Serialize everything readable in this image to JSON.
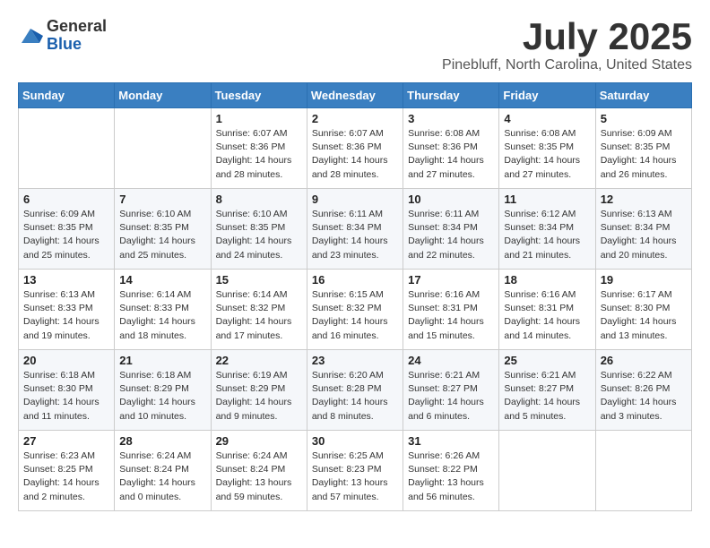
{
  "logo": {
    "general": "General",
    "blue": "Blue"
  },
  "title": "July 2025",
  "subtitle": "Pinebluff, North Carolina, United States",
  "days_of_week": [
    "Sunday",
    "Monday",
    "Tuesday",
    "Wednesday",
    "Thursday",
    "Friday",
    "Saturday"
  ],
  "weeks": [
    [
      {
        "day": "",
        "info": ""
      },
      {
        "day": "",
        "info": ""
      },
      {
        "day": "1",
        "info": "Sunrise: 6:07 AM\nSunset: 8:36 PM\nDaylight: 14 hours and 28 minutes."
      },
      {
        "day": "2",
        "info": "Sunrise: 6:07 AM\nSunset: 8:36 PM\nDaylight: 14 hours and 28 minutes."
      },
      {
        "day": "3",
        "info": "Sunrise: 6:08 AM\nSunset: 8:36 PM\nDaylight: 14 hours and 27 minutes."
      },
      {
        "day": "4",
        "info": "Sunrise: 6:08 AM\nSunset: 8:35 PM\nDaylight: 14 hours and 27 minutes."
      },
      {
        "day": "5",
        "info": "Sunrise: 6:09 AM\nSunset: 8:35 PM\nDaylight: 14 hours and 26 minutes."
      }
    ],
    [
      {
        "day": "6",
        "info": "Sunrise: 6:09 AM\nSunset: 8:35 PM\nDaylight: 14 hours and 25 minutes."
      },
      {
        "day": "7",
        "info": "Sunrise: 6:10 AM\nSunset: 8:35 PM\nDaylight: 14 hours and 25 minutes."
      },
      {
        "day": "8",
        "info": "Sunrise: 6:10 AM\nSunset: 8:35 PM\nDaylight: 14 hours and 24 minutes."
      },
      {
        "day": "9",
        "info": "Sunrise: 6:11 AM\nSunset: 8:34 PM\nDaylight: 14 hours and 23 minutes."
      },
      {
        "day": "10",
        "info": "Sunrise: 6:11 AM\nSunset: 8:34 PM\nDaylight: 14 hours and 22 minutes."
      },
      {
        "day": "11",
        "info": "Sunrise: 6:12 AM\nSunset: 8:34 PM\nDaylight: 14 hours and 21 minutes."
      },
      {
        "day": "12",
        "info": "Sunrise: 6:13 AM\nSunset: 8:34 PM\nDaylight: 14 hours and 20 minutes."
      }
    ],
    [
      {
        "day": "13",
        "info": "Sunrise: 6:13 AM\nSunset: 8:33 PM\nDaylight: 14 hours and 19 minutes."
      },
      {
        "day": "14",
        "info": "Sunrise: 6:14 AM\nSunset: 8:33 PM\nDaylight: 14 hours and 18 minutes."
      },
      {
        "day": "15",
        "info": "Sunrise: 6:14 AM\nSunset: 8:32 PM\nDaylight: 14 hours and 17 minutes."
      },
      {
        "day": "16",
        "info": "Sunrise: 6:15 AM\nSunset: 8:32 PM\nDaylight: 14 hours and 16 minutes."
      },
      {
        "day": "17",
        "info": "Sunrise: 6:16 AM\nSunset: 8:31 PM\nDaylight: 14 hours and 15 minutes."
      },
      {
        "day": "18",
        "info": "Sunrise: 6:16 AM\nSunset: 8:31 PM\nDaylight: 14 hours and 14 minutes."
      },
      {
        "day": "19",
        "info": "Sunrise: 6:17 AM\nSunset: 8:30 PM\nDaylight: 14 hours and 13 minutes."
      }
    ],
    [
      {
        "day": "20",
        "info": "Sunrise: 6:18 AM\nSunset: 8:30 PM\nDaylight: 14 hours and 11 minutes."
      },
      {
        "day": "21",
        "info": "Sunrise: 6:18 AM\nSunset: 8:29 PM\nDaylight: 14 hours and 10 minutes."
      },
      {
        "day": "22",
        "info": "Sunrise: 6:19 AM\nSunset: 8:29 PM\nDaylight: 14 hours and 9 minutes."
      },
      {
        "day": "23",
        "info": "Sunrise: 6:20 AM\nSunset: 8:28 PM\nDaylight: 14 hours and 8 minutes."
      },
      {
        "day": "24",
        "info": "Sunrise: 6:21 AM\nSunset: 8:27 PM\nDaylight: 14 hours and 6 minutes."
      },
      {
        "day": "25",
        "info": "Sunrise: 6:21 AM\nSunset: 8:27 PM\nDaylight: 14 hours and 5 minutes."
      },
      {
        "day": "26",
        "info": "Sunrise: 6:22 AM\nSunset: 8:26 PM\nDaylight: 14 hours and 3 minutes."
      }
    ],
    [
      {
        "day": "27",
        "info": "Sunrise: 6:23 AM\nSunset: 8:25 PM\nDaylight: 14 hours and 2 minutes."
      },
      {
        "day": "28",
        "info": "Sunrise: 6:24 AM\nSunset: 8:24 PM\nDaylight: 14 hours and 0 minutes."
      },
      {
        "day": "29",
        "info": "Sunrise: 6:24 AM\nSunset: 8:24 PM\nDaylight: 13 hours and 59 minutes."
      },
      {
        "day": "30",
        "info": "Sunrise: 6:25 AM\nSunset: 8:23 PM\nDaylight: 13 hours and 57 minutes."
      },
      {
        "day": "31",
        "info": "Sunrise: 6:26 AM\nSunset: 8:22 PM\nDaylight: 13 hours and 56 minutes."
      },
      {
        "day": "",
        "info": ""
      },
      {
        "day": "",
        "info": ""
      }
    ]
  ]
}
